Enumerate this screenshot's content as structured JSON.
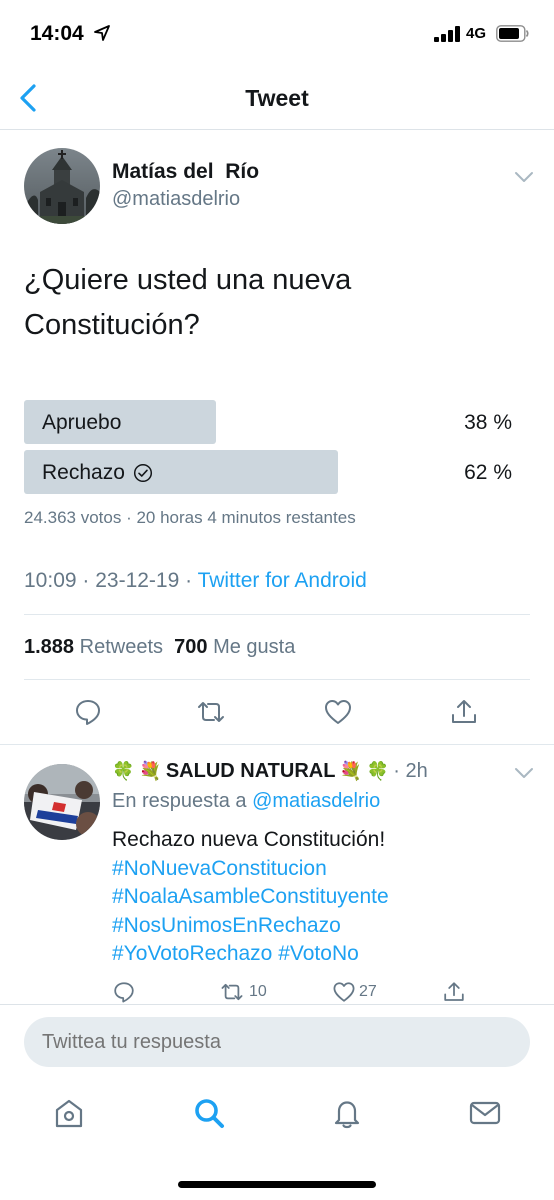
{
  "status_bar": {
    "time": "14:04",
    "network": "4G"
  },
  "nav": {
    "title": "Tweet"
  },
  "tweet": {
    "author_name": "Matías del  Río",
    "author_handle": "@matiasdelrio",
    "text_line1": "¿Quiere usted una nueva",
    "text_line2": "Constitución?",
    "poll": {
      "options": [
        {
          "label": "Apruebo",
          "percent_text": "38 %",
          "fraction": 0.38
        },
        {
          "label": "Rechazo",
          "percent_text": "62 %",
          "fraction": 0.62
        }
      ],
      "meta": "24.363 votos · 20 horas 4 minutos restantes"
    },
    "timestamp": "10:09 · 23-12-19 · ",
    "source": "Twitter for Android",
    "retweets_count": "1.888",
    "retweets_label": "Retweets",
    "likes_count": "700",
    "likes_label": "Me gusta"
  },
  "reply": {
    "emoji_left": "🍀 💐",
    "name": "SALUD NATURAL",
    "emoji_right": "💐 🍀",
    "time": "· 2h",
    "reply_prefix": "En respuesta a ",
    "reply_mention": "@matiasdelrio",
    "text": "Rechazo nueva Constitución!",
    "hashtags": {
      "h1": "#NoNuevaConstitucion",
      "h2": "#NoalaAsambleConstituyente",
      "h3": "#NosUnimosEnRechazo",
      "h4": "#YoVotoRechazo",
      "h5": "#VotoNo"
    },
    "retweet_count": "10",
    "like_count": "27"
  },
  "compose": {
    "placeholder": "Twittea tu respuesta"
  },
  "colors": {
    "accent": "#1da1f2",
    "poll_bar": "#ccd6dd",
    "secondary_text": "#657786"
  },
  "icons": {
    "status": [
      "location-arrow-icon",
      "signal-icon",
      "battery-icon"
    ],
    "tabs": [
      "home-icon",
      "search-icon",
      "notifications-icon",
      "messages-icon"
    ]
  }
}
